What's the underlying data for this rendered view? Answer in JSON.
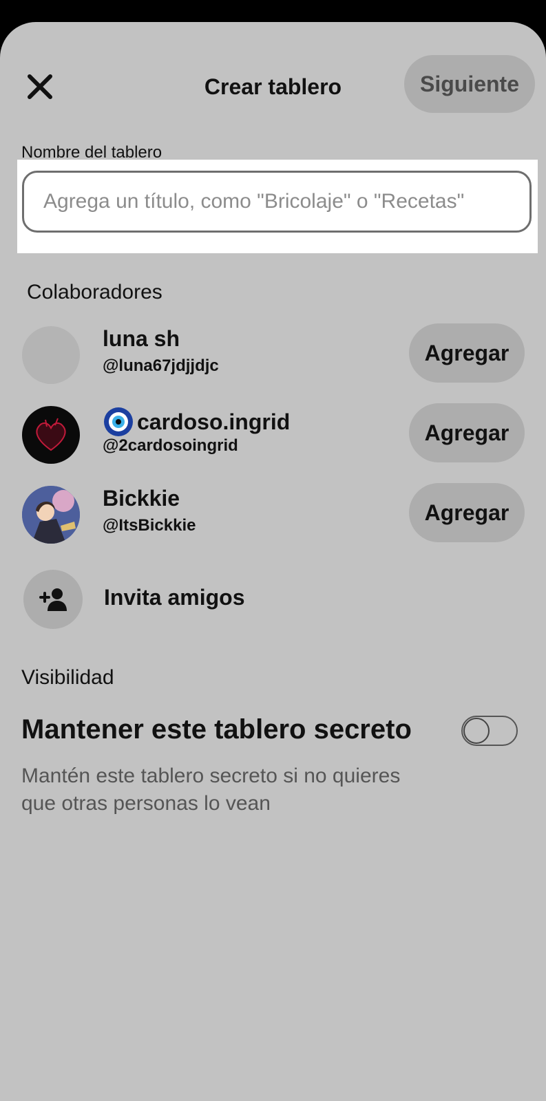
{
  "header": {
    "title": "Crear tablero",
    "next_label": "Siguiente",
    "close_icon": "close-icon"
  },
  "board_name": {
    "label": "Nombre del tablero",
    "value": "",
    "placeholder": "Agrega un título, como \"Bricolaje\" o \"Recetas\""
  },
  "collaborators": {
    "heading": "Colaboradores",
    "items": [
      {
        "name": "luna sh",
        "handle": "@luna67jdjjdjc",
        "add_label": "Agregar"
      },
      {
        "name": "cardoso.ingrid",
        "handle": "@2cardosoingrid",
        "add_label": "Agregar",
        "name_icon": "evil-eye-icon"
      },
      {
        "name": "Bickkie",
        "handle": "@ItsBickkie",
        "add_label": "Agregar"
      }
    ],
    "invite_label": "Invita amigos",
    "invite_icon": "add-person-icon"
  },
  "visibility": {
    "heading": "Visibilidad",
    "secret_title": "Mantener este tablero secreto",
    "secret_description": "Mantén este tablero secreto si no quieres que otras personas lo vean",
    "secret_enabled": false
  },
  "colors": {
    "sheet_background": "#c2c2c2",
    "button_background": "#adadad",
    "input_background": "#ffffff"
  }
}
